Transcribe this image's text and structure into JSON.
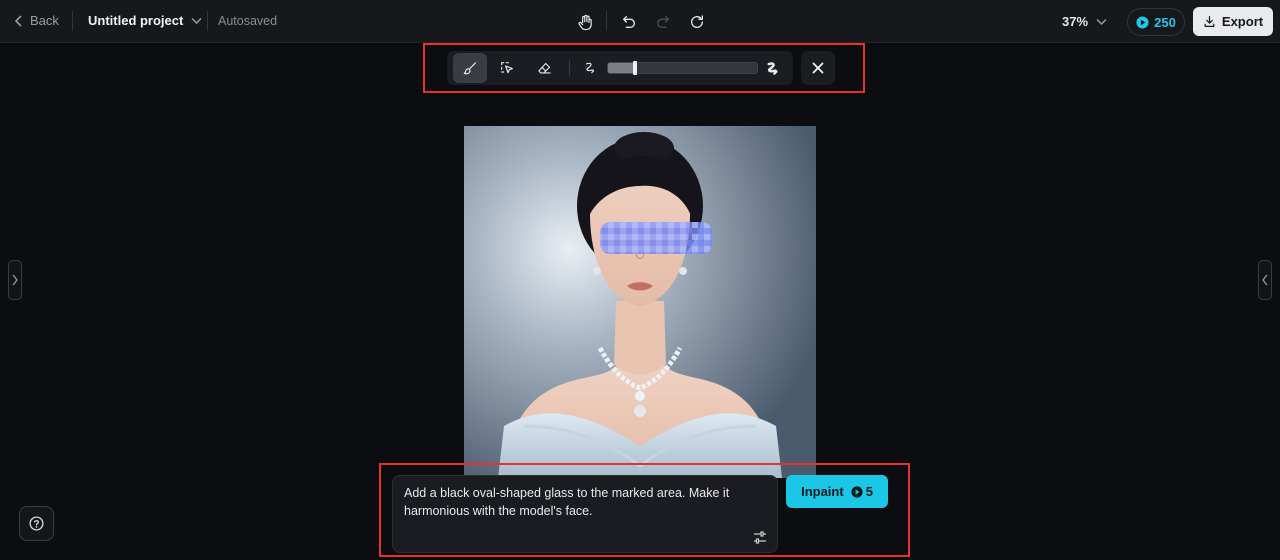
{
  "header": {
    "back_label": "Back",
    "project_title": "Untitled project",
    "save_status": "Autosaved",
    "zoom": "37%",
    "credits": "250",
    "export_label": "Export"
  },
  "prompt": {
    "text": "Add a black oval-shaped glass to the marked area. Make it harmonious with the model's face."
  },
  "inpaint": {
    "label": "Inpaint",
    "cost": "5"
  },
  "brush_size_fraction": 0.18,
  "colors": {
    "accent": "#1cc6e6",
    "highlight_box": "#e5322d",
    "background": "#0c0d10",
    "topbar": "#17181c",
    "mask": "#7d8cff"
  },
  "icons": [
    "chevron-left-icon",
    "chevron-down-icon",
    "hand-icon",
    "undo-icon",
    "redo-icon",
    "refresh-icon",
    "brush-icon",
    "select-icon",
    "eraser-icon",
    "brush-small-icon",
    "brush-large-icon",
    "close-icon",
    "credit-icon",
    "download-icon",
    "settings-sliders-icon",
    "help-icon"
  ]
}
